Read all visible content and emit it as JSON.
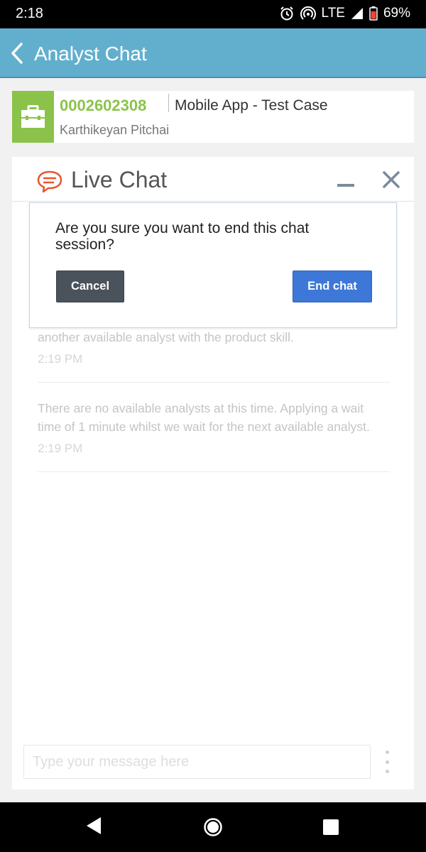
{
  "status_bar": {
    "time": "2:18",
    "network": "LTE",
    "battery": "69%"
  },
  "app_bar": {
    "title": "Analyst Chat"
  },
  "case": {
    "number": "0002602308",
    "subject": "Mobile App - Test Case",
    "owner": "Karthikeyan Pitchai",
    "accent_color": "#8bc34a"
  },
  "chat": {
    "title": "Live Chat",
    "messages": [
      {
        "text": "another available analyst with the product skill.",
        "time": "2:19 PM"
      },
      {
        "text": "There are no available analysts at this time. Applying a wait time of 1 minute whilst we wait for the next available analyst.",
        "time": "2:19 PM"
      }
    ],
    "input_placeholder": "Type your message here"
  },
  "dialog": {
    "message": "Are you sure you want to end this chat session?",
    "cancel_label": "Cancel",
    "end_label": "End chat"
  },
  "colors": {
    "app_bar": "#62afcd",
    "end_button": "#3d78d8",
    "cancel_button": "#4a525c"
  }
}
